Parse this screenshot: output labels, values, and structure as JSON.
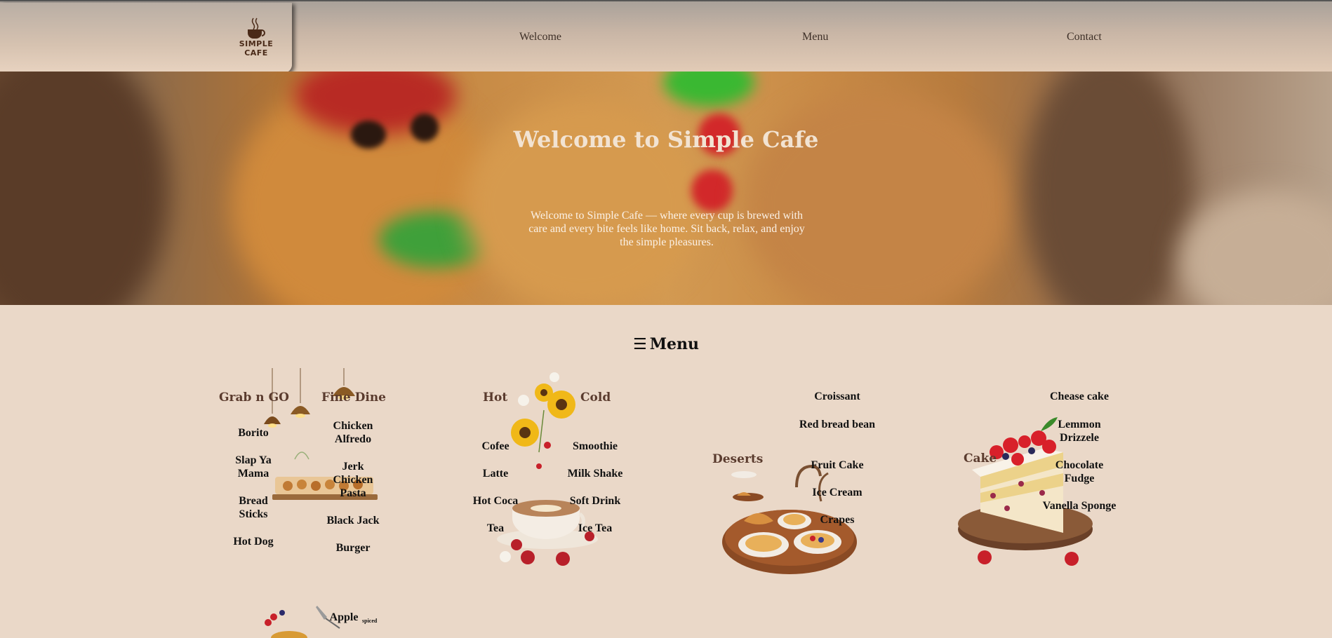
{
  "brand": {
    "logo_line1": "SIMPLE",
    "logo_line2": "CAFE"
  },
  "nav": [
    {
      "label": "Welcome"
    },
    {
      "label": "Menu"
    },
    {
      "label": "Contact"
    }
  ],
  "hero": {
    "title": "Welcome to Simple Cafe",
    "text": "Welcome to Simple Cafe — where every cup is brewed with care and every bite feels like home. Sit back, relax, and enjoy the simple pleasures."
  },
  "menu": {
    "heading": "Menu",
    "icon": "hamburger-icon",
    "food": {
      "grab_n_go": {
        "title": "Grab n GO",
        "items": [
          "Borito",
          "Slap Ya Mama",
          "Bread Sticks",
          "Hot Dog"
        ]
      },
      "fine_dine": {
        "title": "Fine Dine",
        "items": [
          "Chicken Alfredo",
          "Jerk Chicken Pasta",
          "Black Jack",
          "Burger"
        ]
      }
    },
    "drinks": {
      "hot": {
        "title": "Hot",
        "items": [
          "Cofee",
          "Latte",
          "Hot Coca",
          "Tea"
        ]
      },
      "cold": {
        "title": "Cold",
        "items": [
          "Smoothie",
          "Milk Shake",
          "Soft Drink",
          "Ice Tea"
        ]
      }
    },
    "deserts": {
      "title": "Deserts",
      "items": [
        "Croissant",
        "Red bread bean",
        "Fruit Cake",
        "Ice Cream",
        "Crapes"
      ]
    },
    "cake": {
      "title": "Cake",
      "items": [
        "Chease cake",
        "Lemmon Drizzele",
        "Chocolate Fudge",
        "Vanella Sponge"
      ]
    },
    "pies": {
      "item": "Apple",
      "note": "spiced"
    }
  },
  "colors": {
    "page_bg": "#ead8c8",
    "header_bg": "#c9b6a6",
    "heading_brown": "#5a3b2e",
    "hero_title": "#f2e3d2"
  }
}
